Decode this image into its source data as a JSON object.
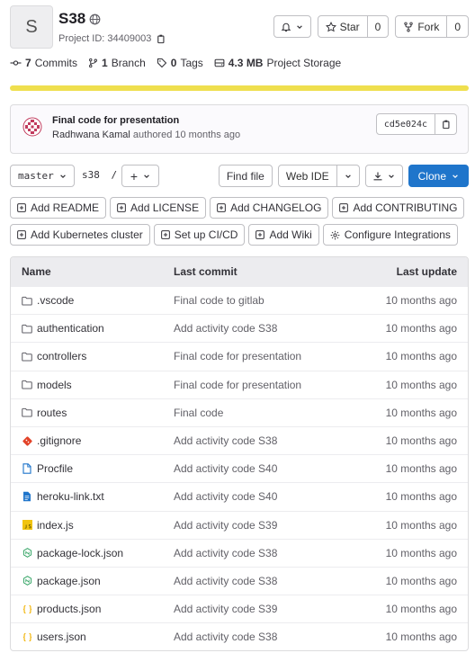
{
  "project": {
    "avatar_letter": "S",
    "name": "S38",
    "id_text": "Project ID: 34409003"
  },
  "header_actions": {
    "notification_count": "",
    "star_label": "Star",
    "star_count": "0",
    "fork_label": "Fork",
    "fork_count": "0"
  },
  "stats": {
    "commits_count": "7",
    "commits_label": "Commits",
    "branches_count": "1",
    "branches_label": "Branch",
    "tags_count": "0",
    "tags_label": "Tags",
    "storage_size": "4.3 MB",
    "storage_label": "Project Storage"
  },
  "language_bar": {
    "color": "#efdf4e",
    "javascript_fraction": 1.0
  },
  "last_commit": {
    "title": "Final code for presentation",
    "author": "Radhwana Kamal",
    "meta_suffix": "authored 10 months ago",
    "sha": "cd5e024c"
  },
  "nav": {
    "branch": "master",
    "path": "s38",
    "path_sep": "/",
    "plus_label": "+",
    "find_file": "Find file",
    "web_ide": "Web IDE",
    "clone": "Clone"
  },
  "quick_actions_row1": [
    "Add README",
    "Add LICENSE",
    "Add CHANGELOG",
    "Add CONTRIBUTING"
  ],
  "quick_actions_row2": [
    "Add Kubernetes cluster",
    "Set up CI/CD",
    "Add Wiki",
    "Configure Integrations"
  ],
  "table": {
    "headers": {
      "name": "Name",
      "last_commit": "Last commit",
      "last_update": "Last update"
    },
    "rows": [
      {
        "name": ".vscode",
        "icon": "folder-icon",
        "commit": "Final code to gitlab",
        "updated": "10 months ago"
      },
      {
        "name": "authentication",
        "icon": "folder-icon",
        "commit": "Add activity code S38",
        "updated": "10 months ago"
      },
      {
        "name": "controllers",
        "icon": "folder-icon",
        "commit": "Final code for presentation",
        "updated": "10 months ago"
      },
      {
        "name": "models",
        "icon": "folder-icon",
        "commit": "Final code for presentation",
        "updated": "10 months ago"
      },
      {
        "name": "routes",
        "icon": "folder-icon",
        "commit": "Final code",
        "updated": "10 months ago"
      },
      {
        "name": ".gitignore",
        "icon": "git-icon",
        "commit": "Add activity code S38",
        "updated": "10 months ago"
      },
      {
        "name": "Procfile",
        "icon": "file-icon",
        "commit": "Add activity code S40",
        "updated": "10 months ago"
      },
      {
        "name": "heroku-link.txt",
        "icon": "text-file-icon",
        "commit": "Add activity code S40",
        "updated": "10 months ago"
      },
      {
        "name": "index.js",
        "icon": "javascript-icon",
        "commit": "Add activity code S39",
        "updated": "10 months ago"
      },
      {
        "name": "package-lock.json",
        "icon": "npm-icon",
        "commit": "Add activity code S38",
        "updated": "10 months ago"
      },
      {
        "name": "package.json",
        "icon": "npm-icon",
        "commit": "Add activity code S38",
        "updated": "10 months ago"
      },
      {
        "name": "products.json",
        "icon": "json-icon",
        "commit": "Add activity code S39",
        "updated": "10 months ago"
      },
      {
        "name": "users.json",
        "icon": "json-icon",
        "commit": "Add activity code S38",
        "updated": "10 months ago"
      }
    ]
  },
  "colors": {
    "accent": "#1f75cb",
    "folder": "#626168",
    "git": "#e24329",
    "file": "#1f75cb",
    "javascript": "#f1c40f",
    "npm": "#2da160",
    "json": "#f1b200"
  }
}
